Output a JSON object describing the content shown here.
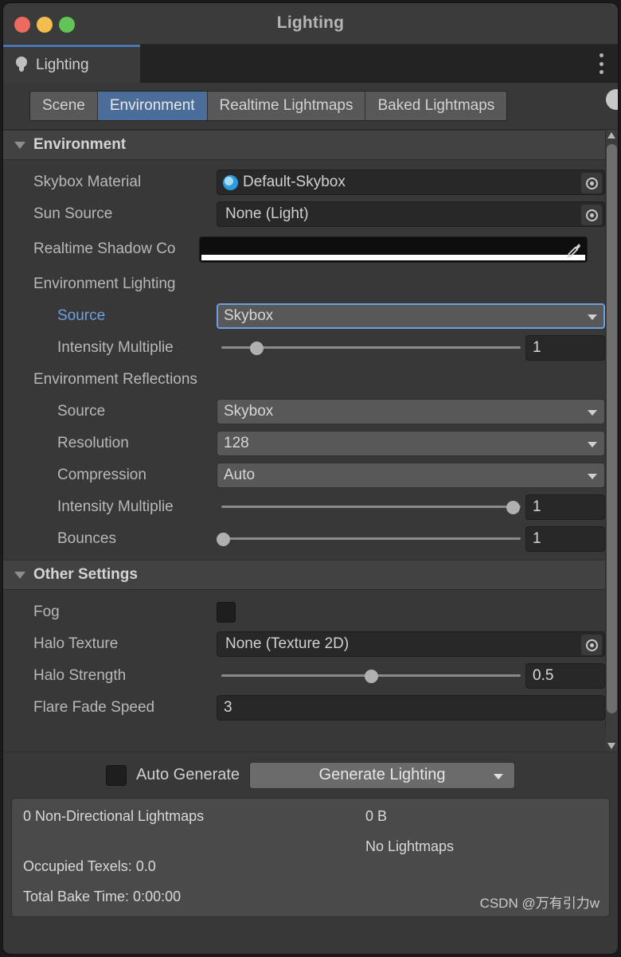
{
  "window": {
    "title": "Lighting",
    "traffic_lights": [
      "close",
      "minimize",
      "zoom"
    ]
  },
  "dock_tab": {
    "label": "Lighting",
    "icon": "light-bulb-icon",
    "menu_icon": "kebab-menu-icon"
  },
  "mode_tabs": [
    {
      "label": "Scene",
      "active": false
    },
    {
      "label": "Environment",
      "active": true
    },
    {
      "label": "Realtime Lightmaps",
      "active": false
    },
    {
      "label": "Baked Lightmaps",
      "active": false
    }
  ],
  "sections": {
    "environment": {
      "title": "Environment",
      "skybox_material": {
        "label": "Skybox Material",
        "value": "Default-Skybox",
        "icon": "material-sphere-icon",
        "picker": "object-picker-icon"
      },
      "sun_source": {
        "label": "Sun Source",
        "value": "None (Light)",
        "picker": "object-picker-icon"
      },
      "realtime_shadow_color": {
        "label": "Realtime Shadow Co",
        "swatch": "#0e0e0e",
        "alpha": "#ffffff",
        "eyedropper": "eyedropper-icon"
      },
      "environment_lighting": {
        "heading": "Environment Lighting",
        "source": {
          "label": "Source",
          "value": "Skybox",
          "focused": true,
          "label_color": "#6f9fe0"
        },
        "intensity_multiplier": {
          "label": "Intensity Multiplie",
          "value": "1",
          "slider_percent": 13
        }
      },
      "environment_reflections": {
        "heading": "Environment Reflections",
        "source": {
          "label": "Source",
          "value": "Skybox"
        },
        "resolution": {
          "label": "Resolution",
          "value": "128"
        },
        "compression": {
          "label": "Compression",
          "value": "Auto"
        },
        "intensity_multiplier": {
          "label": "Intensity Multiplie",
          "value": "1",
          "slider_percent": 96
        },
        "bounces": {
          "label": "Bounces",
          "value": "1",
          "slider_percent": 2
        }
      }
    },
    "other_settings": {
      "title": "Other Settings",
      "fog": {
        "label": "Fog",
        "checked": false
      },
      "halo_texture": {
        "label": "Halo Texture",
        "value": "None (Texture 2D)",
        "picker": "object-picker-icon"
      },
      "halo_strength": {
        "label": "Halo Strength",
        "value": "0.5",
        "slider_percent": 50
      },
      "flare_fade_speed": {
        "label": "Flare Fade Speed",
        "value": "3"
      }
    }
  },
  "footer": {
    "auto_generate": {
      "label": "Auto Generate",
      "checked": false
    },
    "generate_button": {
      "label": "Generate Lighting",
      "caret": "chevron-down-icon"
    }
  },
  "stats": {
    "non_directional_lightmaps": "0 Non-Directional Lightmaps",
    "size": "0 B",
    "no_lightmaps": "No Lightmaps",
    "occupied_texels": "Occupied Texels: 0.0",
    "total_bake_time": "Total Bake Time: 0:00:00"
  },
  "watermark": "CSDN @万有引力w",
  "colors": {
    "accent_blue": "#4b6d99",
    "tab_underline": "#4b78b4",
    "panel_bg": "#383838",
    "header_bg": "#424242",
    "field_bg": "#282828",
    "dropdown_bg": "#585858",
    "link_blue": "#6f9fe0"
  }
}
